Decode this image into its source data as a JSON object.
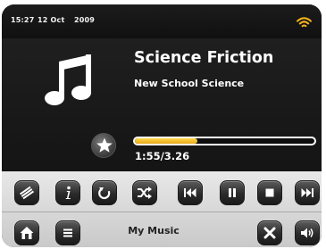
{
  "status_bar": {
    "time": "15:27",
    "date": "12 Oct",
    "year": "2009",
    "wifi_icon": "wifi-icon",
    "wifi_color": "#f3b31b"
  },
  "now_playing": {
    "artwork_icon": "music-note-icon",
    "title": "Science Friction",
    "album": "New School Science",
    "progress_fraction": 0.35,
    "progress_color": "#f2c12e",
    "time_readout": "1:55/3.26",
    "favourite_icon": "star-icon"
  },
  "controls": {
    "row1": [
      "browse-icon",
      "info-icon",
      "repeat-icon",
      "shuffle-icon",
      "previous-icon",
      "pause-icon",
      "stop-icon",
      "next-icon"
    ],
    "row2": [
      "home-icon",
      "menu-icon",
      "close-icon",
      "volume-icon"
    ],
    "source_label": "My Music"
  }
}
